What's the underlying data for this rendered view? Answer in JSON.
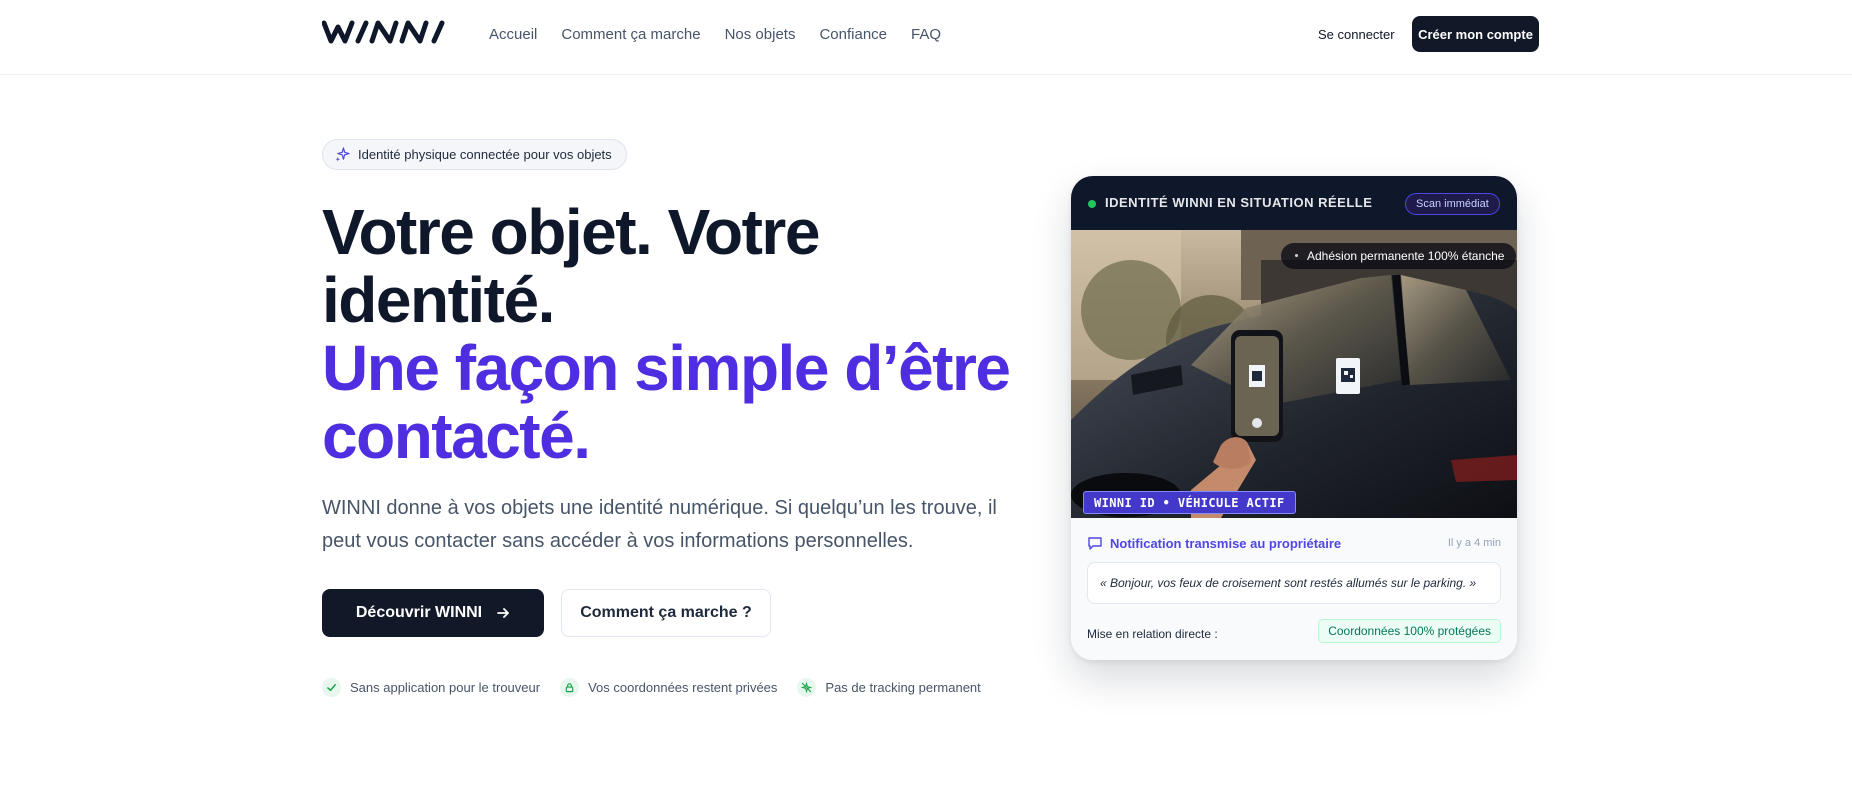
{
  "brand": {
    "logo_text": "WINNI"
  },
  "nav": {
    "links": [
      "Accueil",
      "Comment ça marche",
      "Nos objets",
      "Confiance",
      "FAQ"
    ],
    "login_label": "Se connecter",
    "signup_label": "Créer mon compte"
  },
  "hero": {
    "badge": "Identité physique connectée pour vos objets",
    "title_line1": "Votre objet. Votre identité.",
    "title_line2": "Une façon simple d’être contacté.",
    "lead": "WINNI donne à vos objets une identité numérique. Si quelqu’un les trouve, il peut vous contacter sans accéder à vos informations personnelles.",
    "primary_cta": "Découvrir WINNI",
    "secondary_cta": "Comment ça marche ?",
    "features": [
      {
        "icon": "check-icon",
        "label": "Sans application pour le trouveur"
      },
      {
        "icon": "lock-icon",
        "label": "Vos coordonnées restent privées"
      },
      {
        "icon": "no-tracking-icon",
        "label": "Pas de tracking permanent"
      }
    ]
  },
  "card": {
    "header_title": "IDENTITÉ WINNI EN SITUATION RÉELLE",
    "header_badge": "Scan immédiat",
    "photo_chip": "Adhésion permanente 100% étanche",
    "id_chip": "WINNI ID • VÉHICULE ACTIF",
    "notification_title": "Notification transmise au propriétaire",
    "notification_time": "Il y a 4 min",
    "message": "« Bonjour, vos feux de croisement sont restés allumés sur le parking. »",
    "relation_label": "Mise en relation directe :",
    "protected_badge": "Coordonnées 100% protégées"
  },
  "colors": {
    "accent": "#4f2de0",
    "dark": "#111827",
    "success": "#22c55e",
    "success_text": "#047857"
  }
}
